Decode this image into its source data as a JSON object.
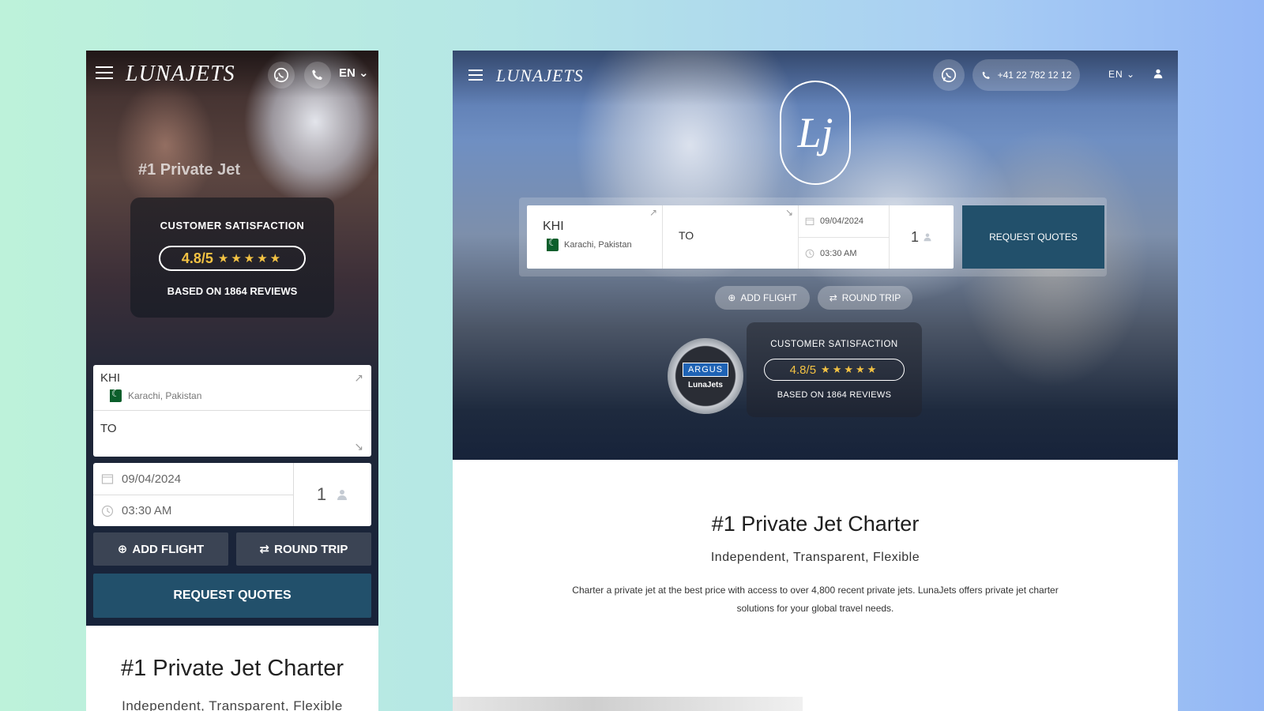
{
  "brand": {
    "logo_text": "LUNAJETS",
    "monogram": "Lj",
    "accent": "#22506b",
    "star_color": "#f3c243"
  },
  "nav": {
    "language": "EN",
    "phone": "+41 22 782 12 12"
  },
  "icons": {
    "menu": "hamburger-icon",
    "whatsapp": "whatsapp-icon",
    "phone": "phone-icon",
    "user": "user-icon",
    "calendar": "calendar-icon",
    "clock": "clock-icon",
    "passenger": "passenger-icon",
    "add": "plus-circle-icon",
    "swap": "swap-icon"
  },
  "satisfaction": {
    "title": "CUSTOMER SATISFACTION",
    "score": "4.8",
    "scale": "/5",
    "stars_full": 4,
    "stars_half": 1,
    "reviews": "BASED ON 1864 REVIEWS"
  },
  "badge": {
    "label": "ARGUS",
    "name": "LunaJets"
  },
  "search": {
    "from_code": "KHI",
    "from_city": "Karachi, Pakistan",
    "to_label": "TO",
    "date": "09/04/2024",
    "time": "03:30 AM",
    "passengers": "1",
    "add_flight": "ADD FLIGHT",
    "round_trip": "ROUND TRIP",
    "request": "REQUEST QUOTES"
  },
  "content": {
    "headline": "#1 Private Jet Charter",
    "subheadline": "Independent, Transparent, Flexible",
    "body": "Charter a private jet at the best price with access to over 4,800 recent private jets. LunaJets offers private jet charter solutions for your global travel needs."
  },
  "mobile": {
    "ghost_headline": "#1 Private Jet"
  }
}
